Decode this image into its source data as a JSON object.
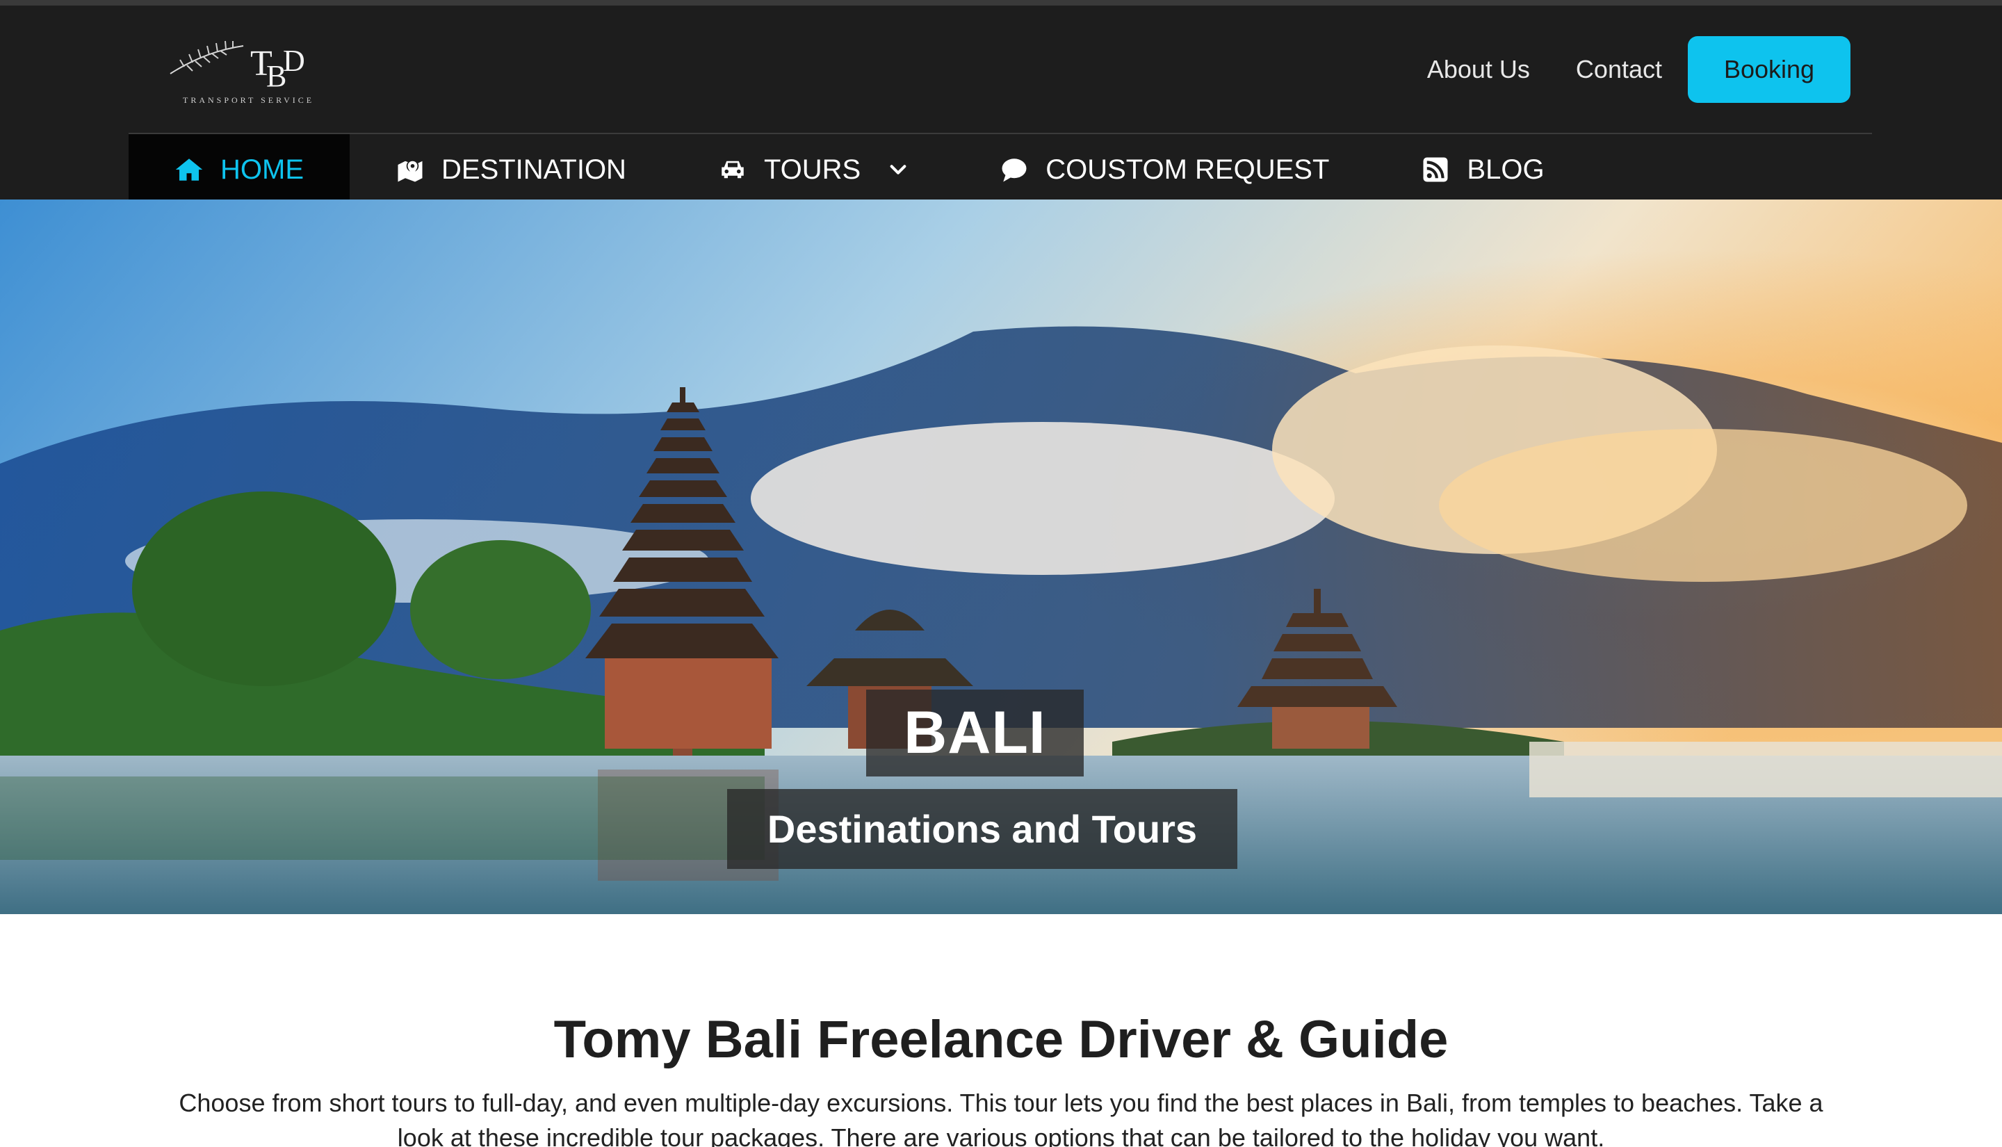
{
  "brand": {
    "logo_letters": "TBD",
    "logo_tagline": "TRANSPORT SERVICE"
  },
  "header": {
    "links": [
      "About Us",
      "Contact"
    ],
    "booking_label": "Booking",
    "accent_color": "#0ec3ee"
  },
  "nav": {
    "items": [
      {
        "label": "HOME",
        "icon": "home-icon",
        "active": true
      },
      {
        "label": "DESTINATION",
        "icon": "map-marker-icon"
      },
      {
        "label": "TOURS",
        "icon": "car-icon",
        "dropdown": true
      },
      {
        "label": "COUSTOM REQUEST",
        "icon": "chat-bubble-icon"
      },
      {
        "label": "BLOG",
        "icon": "rss-icon"
      }
    ]
  },
  "hero": {
    "title": "BALI",
    "subtitle": "Destinations and Tours"
  },
  "content": {
    "title": "Tomy Bali Freelance Driver & Guide",
    "text": "Choose from short tours to full-day, and even multiple-day excursions. This tour lets you find the best places in Bali, from temples to beaches. Take a look at these incredible tour packages. There are various options that can be tailored to the holiday you want."
  }
}
